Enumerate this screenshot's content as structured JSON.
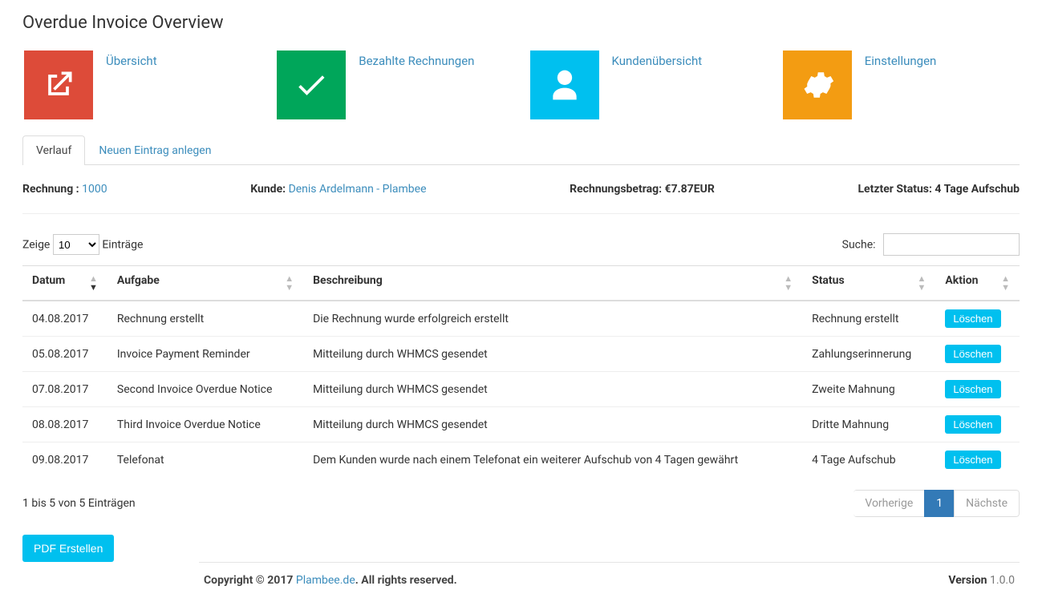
{
  "page": {
    "title": "Overdue Invoice Overview"
  },
  "tiles": [
    {
      "label": "Übersicht",
      "color": "bg-red",
      "icon": "external-link"
    },
    {
      "label": "Bezahlte Rechnungen",
      "color": "bg-green",
      "icon": "check"
    },
    {
      "label": "Kundenübersicht",
      "color": "bg-aqua",
      "icon": "user"
    },
    {
      "label": "Einstellungen",
      "color": "bg-orange",
      "icon": "gears"
    }
  ],
  "tabs": {
    "active": "Verlauf",
    "other": "Neuen Eintrag anlegen"
  },
  "summary": {
    "invoice_label": "Rechnung :",
    "invoice_no": "1000",
    "customer_label": "Kunde:",
    "customer_name": "Denis Ardelmann - Plambee",
    "amount_label": "Rechnungsbetrag:",
    "amount_value": "€7.87EUR",
    "status_label": "Letzter Status:",
    "status_value": "4 Tage Aufschub"
  },
  "datatable": {
    "length_prefix": "Zeige",
    "length_value": "10",
    "length_suffix": "Einträge",
    "search_label": "Suche:",
    "search_value": "",
    "columns": [
      "Datum",
      "Aufgabe",
      "Beschreibung",
      "Status",
      "Aktion"
    ],
    "action_button": "Löschen",
    "rows": [
      {
        "date": "04.08.2017",
        "task": "Rechnung erstellt",
        "desc": "Die Rechnung wurde erfolgreich erstellt",
        "status": "Rechnung erstellt"
      },
      {
        "date": "05.08.2017",
        "task": "Invoice Payment Reminder",
        "desc": "Mitteilung durch WHMCS gesendet",
        "status": "Zahlungserinnerung"
      },
      {
        "date": "07.08.2017",
        "task": "Second Invoice Overdue Notice",
        "desc": "Mitteilung durch WHMCS gesendet",
        "status": "Zweite Mahnung"
      },
      {
        "date": "08.08.2017",
        "task": "Third Invoice Overdue Notice",
        "desc": "Mitteilung durch WHMCS gesendet",
        "status": "Dritte Mahnung"
      },
      {
        "date": "09.08.2017",
        "task": "Telefonat",
        "desc": "Dem Kunden wurde nach einem Telefonat ein weiterer Aufschub von 4 Tagen gewährt",
        "status": "4 Tage Aufschub"
      }
    ],
    "info": "1 bis 5 von 5 Einträgen",
    "prev": "Vorherige",
    "page": "1",
    "next": "Nächste"
  },
  "buttons": {
    "pdf": "PDF Erstellen"
  },
  "footer": {
    "copyright_prefix": "Copyright © 2017 ",
    "brand": "Plambee.de",
    "copyright_suffix": ". All rights reserved.",
    "version_label": "Version",
    "version": " 1.0.0"
  }
}
